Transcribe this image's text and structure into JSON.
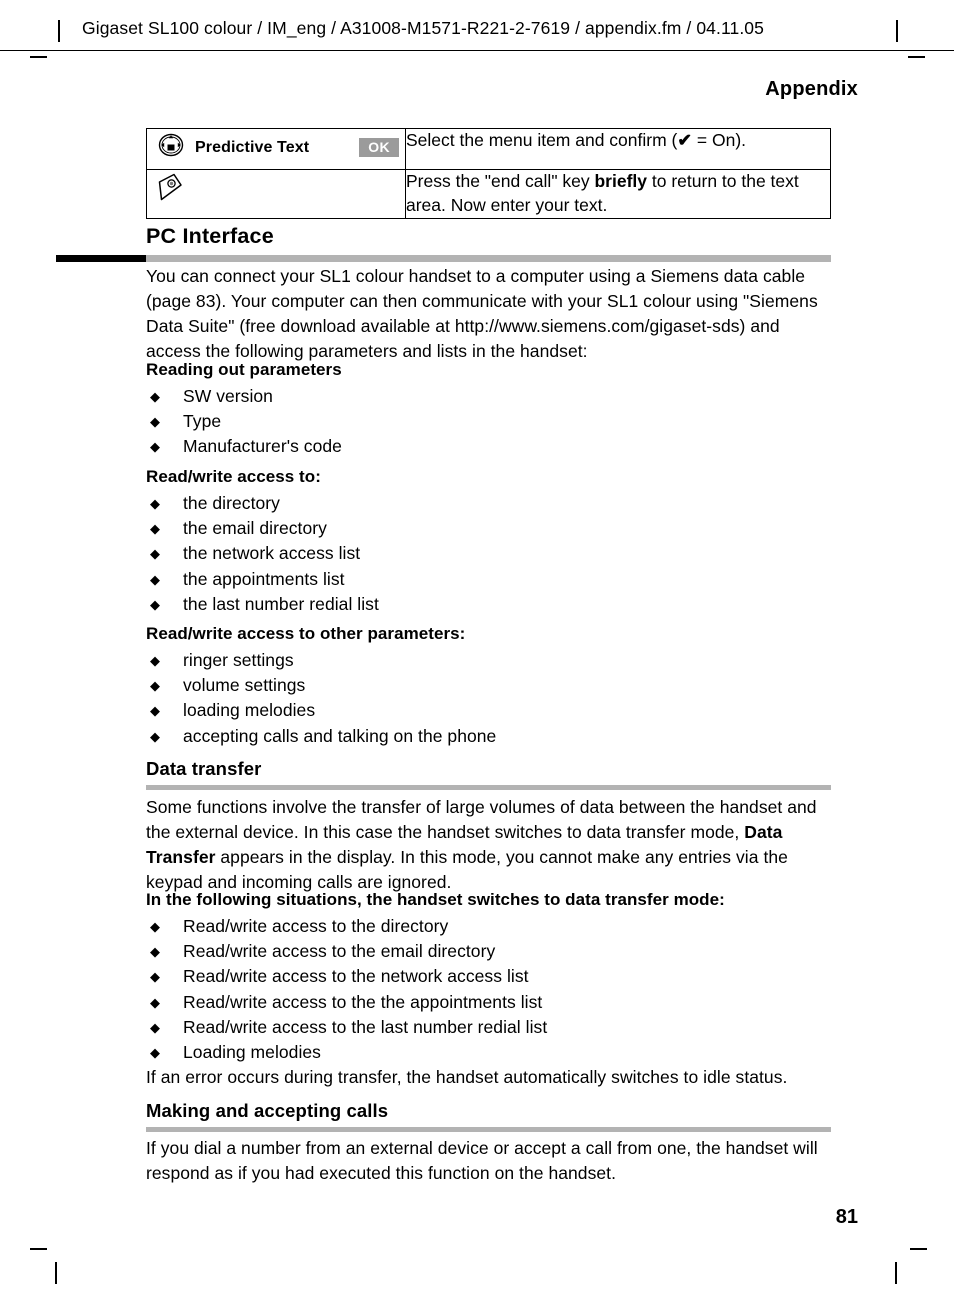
{
  "header": {
    "document_path": "Gigaset SL100 colour / IM_eng / A31008-M1571-R221-2-7619 / appendix.fm / 04.11.05",
    "chapter_title": "Appendix"
  },
  "icon_table": {
    "rows": [
      {
        "icon": "nav-key-icon",
        "label": "Predictive Text",
        "softkey": "OK",
        "description_prefix": "Select the menu item and confirm (",
        "description_check": "✔",
        "description_suffix": " = On)."
      },
      {
        "icon": "end-call-key-icon",
        "label": "",
        "softkey": "",
        "description_part1": "Press the \"end call\" key ",
        "description_bold": "briefly",
        "description_part2": " to return to the text area. Now enter your text."
      }
    ]
  },
  "sections": {
    "pc_interface": {
      "heading": "PC Interface",
      "intro": "You can connect your SL1 colour handset to a computer using a Siemens data cable (page 83). Your computer can then communicate with your SL1 colour using \"Siemens Data Suite\" (free download available at http://www.siemens.com/gigaset-sds) and access the following parameters and lists in the handset:",
      "group1": {
        "title": "Reading out parameters",
        "items": [
          "SW version",
          "Type",
          "Manufacturer's code"
        ]
      },
      "group2": {
        "title": "Read/write access to:",
        "items": [
          "the directory",
          "the email directory",
          "the network access list",
          "the appointments list",
          "the last number redial list"
        ]
      },
      "group3": {
        "title": "Read/write access to other parameters:",
        "items": [
          "ringer settings",
          "volume settings",
          "loading melodies",
          "accepting calls and talking on the phone"
        ]
      }
    },
    "data_transfer": {
      "heading": "Data transfer",
      "paragraph_part1": "Some functions involve the transfer of large volumes of data between the handset and the external device. In this case the handset switches to data transfer mode, ",
      "paragraph_bold": "Data Transfer",
      "paragraph_part2": " appears in the display. In this mode, you cannot make any entries via the keypad and incoming calls are ignored.",
      "list_title": "In the following situations, the handset switches to data transfer mode:",
      "items": [
        "Read/write access to the directory",
        "Read/write access to the email directory",
        "Read/write access to the network access list",
        "Read/write access to the the appointments list",
        "Read/write access to the last number redial list",
        "Loading melodies"
      ],
      "closing": "If an error occurs during transfer, the handset automatically switches to idle status."
    },
    "making_calls": {
      "heading": "Making and accepting calls",
      "paragraph": "If you dial a number from an external device or accept a call from one, the handset will respond as if you had executed this function on the handset."
    }
  },
  "footer": {
    "page_number": "81"
  },
  "colors": {
    "rule_grey": "#b3b3b3",
    "rule_black": "#000000",
    "softkey_grey": "#9b9b9b"
  }
}
